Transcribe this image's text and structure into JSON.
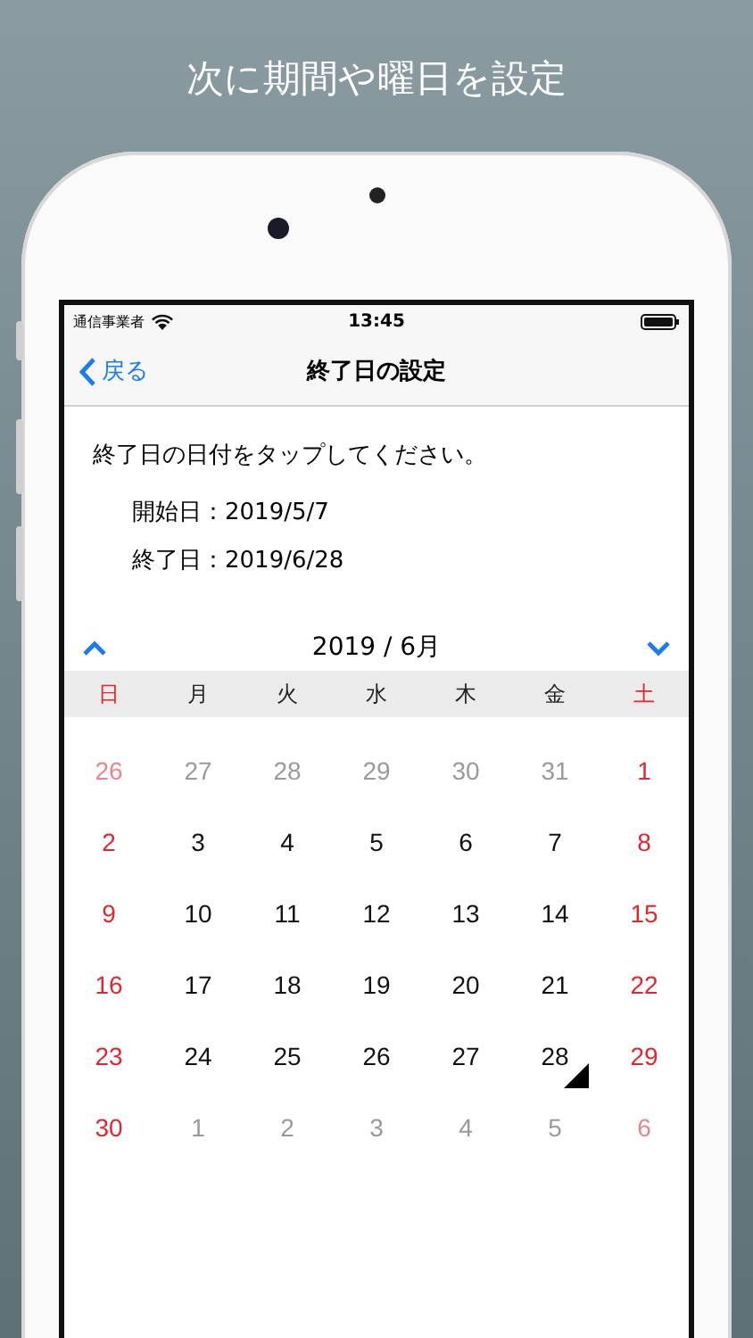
{
  "headline": "次に期間や曜日を設定",
  "status_bar": {
    "carrier": "通信事業者",
    "time": "13:45"
  },
  "nav_bar": {
    "back": "戻る",
    "title": "終了日の設定"
  },
  "instruction": "終了日の日付をタップしてください。",
  "dates": [
    {
      "label": "開始日：",
      "value": "2019/5/7"
    },
    {
      "label": "終了日：",
      "value": "2019/6/28"
    }
  ],
  "calendar": {
    "month": "2019 / 6月",
    "weekdays": [
      {
        "label": "日",
        "weekend": true
      },
      {
        "label": "月",
        "weekend": false
      },
      {
        "label": "火",
        "weekend": false
      },
      {
        "label": "水",
        "weekend": false
      },
      {
        "label": "木",
        "weekend": false
      },
      {
        "label": "金",
        "weekend": false
      },
      {
        "label": "土",
        "weekend": true
      }
    ],
    "weeks": [
      [
        {
          "day": "26",
          "muted": true,
          "selected": false
        },
        {
          "day": "27",
          "muted": true,
          "selected": false
        },
        {
          "day": "28",
          "muted": true,
          "selected": false
        },
        {
          "day": "29",
          "muted": true,
          "selected": false
        },
        {
          "day": "30",
          "muted": true,
          "selected": false
        },
        {
          "day": "31",
          "muted": true,
          "selected": false
        },
        {
          "day": "1",
          "muted": false,
          "selected": false
        }
      ],
      [
        {
          "day": "2",
          "muted": false,
          "selected": false
        },
        {
          "day": "3",
          "muted": false,
          "selected": false
        },
        {
          "day": "4",
          "muted": false,
          "selected": false
        },
        {
          "day": "5",
          "muted": false,
          "selected": false
        },
        {
          "day": "6",
          "muted": false,
          "selected": false
        },
        {
          "day": "7",
          "muted": false,
          "selected": false
        },
        {
          "day": "8",
          "muted": false,
          "selected": false
        }
      ],
      [
        {
          "day": "9",
          "muted": false,
          "selected": false
        },
        {
          "day": "10",
          "muted": false,
          "selected": false
        },
        {
          "day": "11",
          "muted": false,
          "selected": false
        },
        {
          "day": "12",
          "muted": false,
          "selected": false
        },
        {
          "day": "13",
          "muted": false,
          "selected": false
        },
        {
          "day": "14",
          "muted": false,
          "selected": false
        },
        {
          "day": "15",
          "muted": false,
          "selected": false
        }
      ],
      [
        {
          "day": "16",
          "muted": false,
          "selected": false
        },
        {
          "day": "17",
          "muted": false,
          "selected": false
        },
        {
          "day": "18",
          "muted": false,
          "selected": false
        },
        {
          "day": "19",
          "muted": false,
          "selected": false
        },
        {
          "day": "20",
          "muted": false,
          "selected": false
        },
        {
          "day": "21",
          "muted": false,
          "selected": false
        },
        {
          "day": "22",
          "muted": false,
          "selected": false
        }
      ],
      [
        {
          "day": "23",
          "muted": false,
          "selected": false
        },
        {
          "day": "24",
          "muted": false,
          "selected": false
        },
        {
          "day": "25",
          "muted": false,
          "selected": false
        },
        {
          "day": "26",
          "muted": false,
          "selected": false
        },
        {
          "day": "27",
          "muted": false,
          "selected": false
        },
        {
          "day": "28",
          "muted": false,
          "selected": true
        },
        {
          "day": "29",
          "muted": false,
          "selected": false
        }
      ],
      [
        {
          "day": "30",
          "muted": false,
          "selected": false
        },
        {
          "day": "1",
          "muted": true,
          "selected": false
        },
        {
          "day": "2",
          "muted": true,
          "selected": false
        },
        {
          "day": "3",
          "muted": true,
          "selected": false
        },
        {
          "day": "4",
          "muted": true,
          "selected": false
        },
        {
          "day": "5",
          "muted": true,
          "selected": false
        },
        {
          "day": "6",
          "muted": true,
          "selected": false
        }
      ]
    ]
  }
}
